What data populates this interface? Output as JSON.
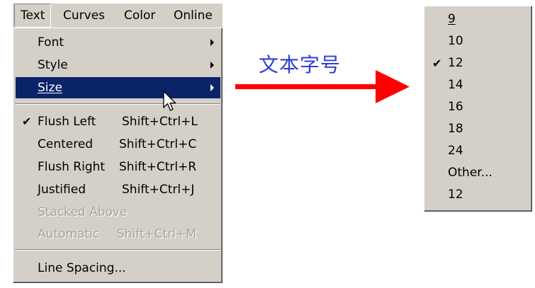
{
  "menubar": {
    "items": [
      {
        "label": "Text",
        "active": true
      },
      {
        "label": "Curves"
      },
      {
        "label": "Color"
      },
      {
        "label": "Online"
      }
    ]
  },
  "text_menu": {
    "font": "Font",
    "style": "Style",
    "size": "Size",
    "flush_left": {
      "label": "Flush Left",
      "shortcut": "Shift+Ctrl+L",
      "checked": true
    },
    "centered": {
      "label": "Centered",
      "shortcut": "Shift+Ctrl+C"
    },
    "flush_right": {
      "label": "Flush Right",
      "shortcut": "Shift+Ctrl+R"
    },
    "justified": {
      "label": "Justified",
      "shortcut": "Shift+Ctrl+J"
    },
    "stacked_above": {
      "label": "Stacked Above",
      "disabled": true
    },
    "automatic": {
      "label": "Automatic",
      "shortcut": "Shift+Ctrl+M",
      "disabled": true
    },
    "line_spacing": "Line Spacing...",
    "check_glyph": "✔"
  },
  "annotation": {
    "text": "文本字号",
    "color": "#2d3fd1",
    "arrow_color": "#ff0000"
  },
  "size_submenu": {
    "items": [
      {
        "label": "9"
      },
      {
        "label": "10"
      },
      {
        "label": "12",
        "checked": true
      },
      {
        "label": "14"
      },
      {
        "label": "16"
      },
      {
        "label": "18"
      },
      {
        "label": "24"
      },
      {
        "label": "Other..."
      },
      {
        "label": "12"
      }
    ]
  },
  "colors": {
    "menu_bg": "#d4d0c8",
    "highlight": "#0a246a",
    "disabled_text": "#a7a49b"
  }
}
